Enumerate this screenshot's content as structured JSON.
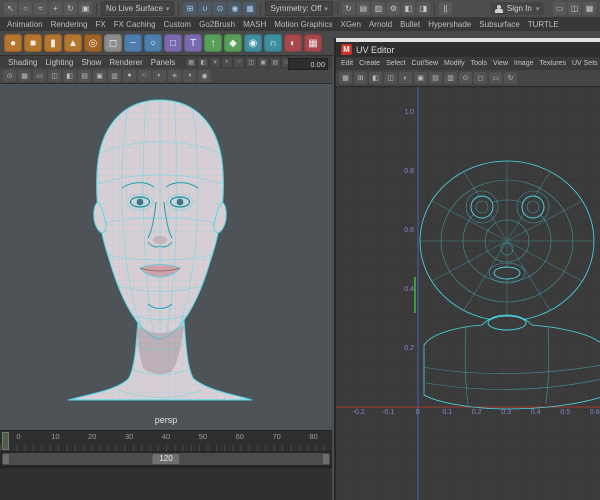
{
  "colors": {
    "wireframe": "#49dbe9",
    "head_fill": "#d9ced3",
    "viewport_bg": "#4e5357",
    "uv_bg": "#3b3b3b",
    "axis_x_red": "#a8392f",
    "axis_y_blue": "#4a5fc0",
    "axis_green": "#3f9b3f"
  },
  "topbar": {
    "tool_icons": [
      {
        "name": "select-tool-icon",
        "glyph": "↖"
      },
      {
        "name": "lasso-select-icon",
        "glyph": "○"
      },
      {
        "name": "paint-select-icon",
        "glyph": "≈"
      },
      {
        "name": "move-tool-icon",
        "glyph": "+"
      },
      {
        "name": "rotate-tool-icon",
        "glyph": "↻"
      },
      {
        "name": "scale-tool-icon",
        "glyph": "▣"
      }
    ],
    "live_surface_label": "No Live Surface",
    "symmetry_label": "Symmetry: Off",
    "snap_icons": [
      {
        "name": "snap-grid-icon",
        "glyph": "⊞"
      },
      {
        "name": "snap-curve-icon",
        "glyph": "∪"
      },
      {
        "name": "snap-point-icon",
        "glyph": "⊙"
      },
      {
        "name": "snap-projected-center-icon",
        "glyph": "◉"
      },
      {
        "name": "make-live-icon",
        "glyph": "▦"
      }
    ],
    "util_icons": [
      {
        "name": "construction-history-icon",
        "glyph": "↻"
      },
      {
        "name": "render-view-icon",
        "glyph": "▤"
      },
      {
        "name": "ipr-render-icon",
        "glyph": "▥"
      },
      {
        "name": "render-settings-icon",
        "glyph": "⚙"
      },
      {
        "name": "display-layer-icon",
        "glyph": "◧"
      },
      {
        "name": "anim-layer-icon",
        "glyph": "◨"
      }
    ],
    "pause_glyph": "||",
    "sign_in_label": "Sign In",
    "right_icons": [
      {
        "name": "layout-single-pane-icon",
        "glyph": "▭"
      },
      {
        "name": "layout-two-pane-icon",
        "glyph": "◫"
      },
      {
        "name": "layout-four-pane-icon",
        "glyph": "▦"
      }
    ]
  },
  "menu_tabs": [
    "Animation",
    "Rendering",
    "FX",
    "FX Caching",
    "Custom",
    "Go2Brush",
    "MASH",
    "Motion Graphics",
    "XGen",
    "Arnold",
    "Bullet",
    "Hypershade",
    "Subsurface",
    "TURTLE"
  ],
  "shelf": {
    "items": [
      {
        "name": "shelf-poly-sphere",
        "color": "#b5762f",
        "glyph": "●"
      },
      {
        "name": "shelf-poly-cube",
        "color": "#b5762f",
        "glyph": "■"
      },
      {
        "name": "shelf-poly-cylinder",
        "color": "#b5762f",
        "glyph": "▮"
      },
      {
        "name": "shelf-poly-cone",
        "color": "#b5762f",
        "glyph": "▲"
      },
      {
        "name": "shelf-poly-torus",
        "color": "#a06428",
        "glyph": "◎"
      },
      {
        "name": "shelf-poly-plane",
        "color": "#8c8c8c",
        "glyph": "◻"
      },
      {
        "name": "shelf-curve-tool",
        "color": "#4f7fae",
        "glyph": "~"
      },
      {
        "name": "shelf-nurbs-circle",
        "color": "#4f7fae",
        "glyph": "○"
      },
      {
        "name": "shelf-nurbs-square",
        "color": "#7a6bb0",
        "glyph": "□"
      },
      {
        "name": "shelf-text-tool",
        "color": "#7a6bb0",
        "glyph": "T"
      },
      {
        "name": "shelf-extrude",
        "color": "#58a05a",
        "glyph": "↑"
      },
      {
        "name": "shelf-bevel",
        "color": "#58a05a",
        "glyph": "◆"
      },
      {
        "name": "shelf-boolean",
        "color": "#3f8f9e",
        "glyph": "◉"
      },
      {
        "name": "shelf-smooth",
        "color": "#3f8f9e",
        "glyph": "∩"
      },
      {
        "name": "shelf-mirror",
        "color": "#a9474f",
        "glyph": "◐"
      },
      {
        "name": "shelf-lattice",
        "color": "#a9474f",
        "glyph": "▦"
      }
    ]
  },
  "viewport": {
    "menus": [
      "Shading",
      "Lighting",
      "Show",
      "Renderer",
      "Panels"
    ],
    "menubar_icons": [
      {
        "name": "vp-grid-icon",
        "glyph": "▦"
      },
      {
        "name": "vp-camera-icon",
        "glyph": "◧"
      },
      {
        "name": "vp-light-icon",
        "glyph": "☀"
      },
      {
        "name": "vp-texture-icon",
        "glyph": "◐"
      },
      {
        "name": "vp-xray-icon",
        "glyph": "○"
      },
      {
        "name": "vp-wire-shaded-icon",
        "glyph": "◫"
      },
      {
        "name": "vp-isolate-icon",
        "glyph": "▣"
      },
      {
        "name": "vp-plane-icon",
        "glyph": "▤"
      },
      {
        "name": "vp-gate-icon",
        "glyph": "▭"
      },
      {
        "name": "vp-aa-icon",
        "glyph": "⊙"
      }
    ],
    "toolbar_icons": [
      {
        "name": "camera-lock-icon",
        "glyph": "⊙"
      },
      {
        "name": "grid-toggle-icon",
        "glyph": "▦"
      },
      {
        "name": "film-gate-icon",
        "glyph": "▭"
      },
      {
        "name": "resolution-gate-icon",
        "glyph": "◫"
      },
      {
        "name": "gate-mask-icon",
        "glyph": "◧"
      },
      {
        "name": "field-chart-icon",
        "glyph": "▤"
      },
      {
        "name": "safe-action-icon",
        "glyph": "▣"
      },
      {
        "name": "safe-title-icon",
        "glyph": "▥"
      },
      {
        "name": "shading-smooth-icon",
        "glyph": "●"
      },
      {
        "name": "wireframe-icon",
        "glyph": "○"
      },
      {
        "name": "textured-icon",
        "glyph": "◐"
      },
      {
        "name": "lighting-icon",
        "glyph": "☀"
      },
      {
        "name": "shadows-icon",
        "glyph": "◑"
      },
      {
        "name": "ambient-occlusion-icon",
        "glyph": "◉"
      }
    ],
    "coord_value": "0.00",
    "camera_label": "persp"
  },
  "timeline": {
    "ticks": [
      "0",
      "10",
      "20",
      "30",
      "40",
      "50",
      "60",
      "70",
      "80"
    ],
    "range_end": "120"
  },
  "uv_editor": {
    "logo_glyph": "M",
    "title": "UV Editor",
    "menus": [
      "Edit",
      "Create",
      "Select",
      "Cut/Sew",
      "Modify",
      "Tools",
      "View",
      "Image",
      "Textures",
      "UV Sets",
      "Help"
    ],
    "toolbar_icons": [
      {
        "name": "uv-grid-icon",
        "glyph": "▦"
      },
      {
        "name": "uv-snap-icon",
        "glyph": "⊞"
      },
      {
        "name": "uv-isolate-icon",
        "glyph": "◧"
      },
      {
        "name": "uv-texture-toggle-icon",
        "glyph": "◫"
      },
      {
        "name": "uv-shaded-icon",
        "glyph": "◐"
      },
      {
        "name": "uv-borders-icon",
        "glyph": "▣"
      },
      {
        "name": "uv-distortion-icon",
        "glyph": "▤"
      },
      {
        "name": "uv-checker-icon",
        "glyph": "▥"
      },
      {
        "name": "uv-pixel-snap-icon",
        "glyph": "⊙"
      },
      {
        "name": "uv-tile-icon",
        "glyph": "◻"
      },
      {
        "name": "uv-frame-icon",
        "glyph": "▭"
      },
      {
        "name": "uv-refresh-icon",
        "glyph": "↻"
      }
    ],
    "axis": {
      "x_ticks": [
        "-0.2",
        "-0.1",
        "0",
        "0.1",
        "0.2",
        "0.3",
        "0.4",
        "0.5",
        "0.6"
      ],
      "y_ticks": [
        "1.0",
        "0.8",
        "0.6",
        "0.4",
        "0.2"
      ]
    }
  }
}
